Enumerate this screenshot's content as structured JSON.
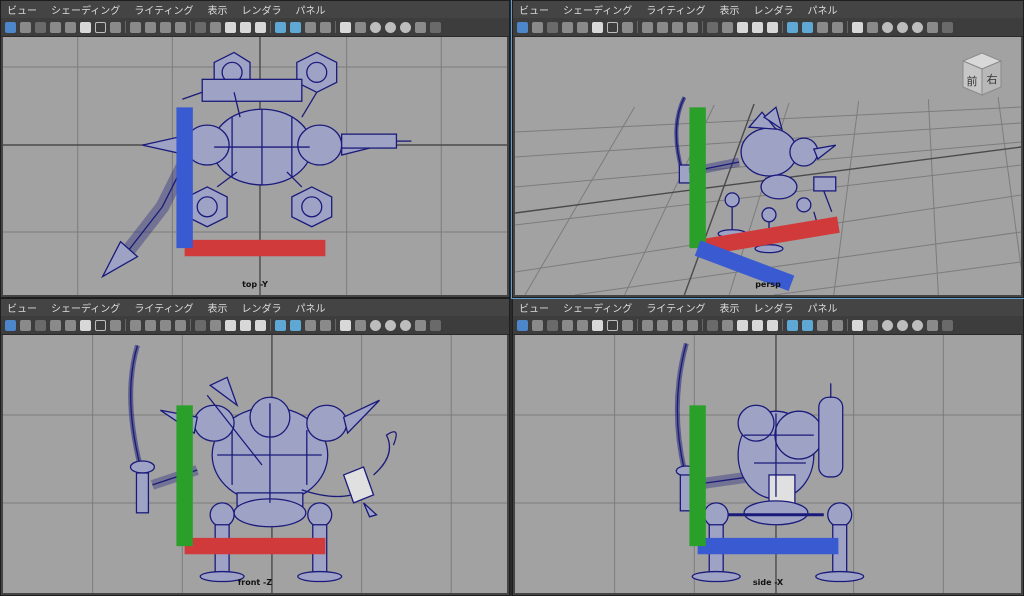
{
  "menu": {
    "view": "ビュー",
    "shading": "シェーディング",
    "lighting": "ライティング",
    "show": "表示",
    "renderer": "レンダラ",
    "panels": "パネル"
  },
  "panels": {
    "top": {
      "camera_label": "top -Y"
    },
    "persp": {
      "camera_label": "persp",
      "viewcube_front": "前",
      "viewcube_right": "右"
    },
    "front": {
      "camera_label": "front -Z"
    },
    "side": {
      "camera_label": "side -X"
    }
  },
  "colors": {
    "viewport_bg": "#a2a2a2",
    "wire": "#1a1a7a",
    "grid": "#7c7c7c",
    "grid_axis": "#4a4a4a",
    "axis_x": "#d13a3a",
    "axis_y": "#2aa02a",
    "axis_z": "#3a5ad1"
  },
  "toolbar_icons": [
    "select-camera-icon",
    "camera-attributes-icon",
    "bookmark-icon",
    "image-plane-icon",
    "grid-icon",
    "film-gate-icon",
    "resolution-gate-icon",
    "gate-mask-icon",
    "wireframe-icon",
    "smooth-shade-icon",
    "textured-icon",
    "lights-icon",
    "shadows-icon",
    "ambient-occlusion-icon",
    "isolate-icon",
    "xray-icon"
  ]
}
